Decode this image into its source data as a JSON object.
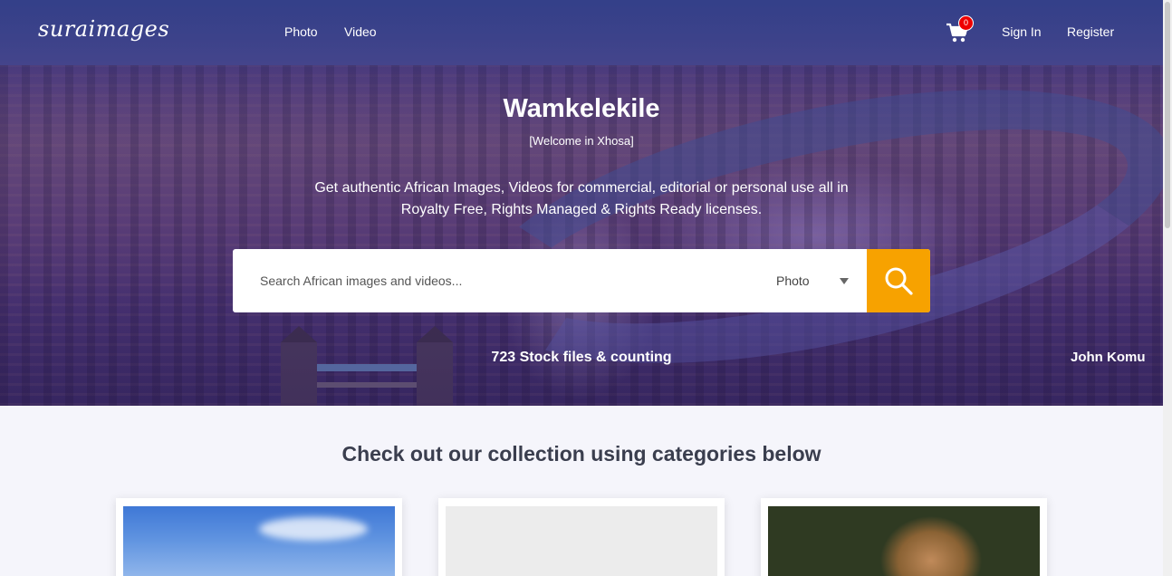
{
  "header": {
    "logo_text": "suraimages",
    "nav": [
      {
        "label": "Photo"
      },
      {
        "label": "Video"
      }
    ],
    "cart_count": "0",
    "sign_in": "Sign In",
    "register": "Register"
  },
  "hero": {
    "title": "Wamkelekile",
    "subtitle": "[Welcome in Xhosa]",
    "description": "Get authentic African Images, Videos for commercial, editorial or personal use all in Royalty Free, Rights Managed & Rights Ready licenses.",
    "search": {
      "placeholder": "Search African images and videos...",
      "type_selected": "Photo"
    },
    "stock_count": "723 Stock files & counting",
    "photo_credit": "John Komu"
  },
  "categories": {
    "heading": "Check out our collection using categories below"
  },
  "colors": {
    "accent": "#f7a200",
    "badge": "#e00000"
  }
}
